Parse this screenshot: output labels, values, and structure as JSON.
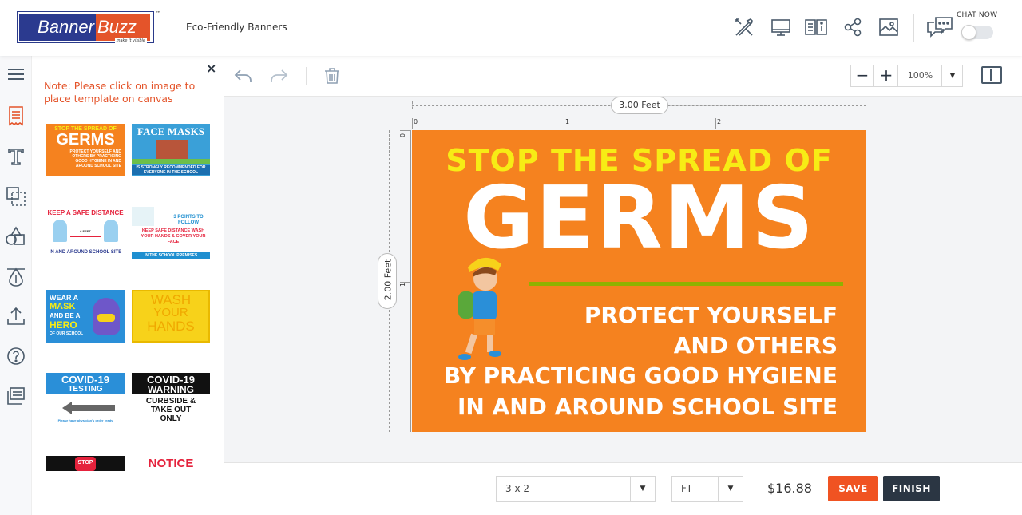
{
  "header": {
    "logo_part1": "Banner",
    "logo_part2": "Buzz",
    "logo_tm": "™",
    "logo_tagline": "make it visible",
    "product_title": "Eco-Friendly Banners",
    "icons": [
      "tools-icon",
      "monitor-icon",
      "book-info-icon",
      "share-icon",
      "image-icon",
      "chat-icon"
    ],
    "chat_label": "CHAT NOW"
  },
  "leftrail": {
    "icons": [
      "menu-icon",
      "templates-icon",
      "text-icon",
      "shapes-icon",
      "clipart-icon",
      "background-icon",
      "upload-icon",
      "help-icon",
      "layers-icon"
    ]
  },
  "panel": {
    "close": "×",
    "note": "Note: Please click on image to place template on canvas",
    "templates": [
      {
        "l1": "STOP THE SPREAD OF",
        "l2": "GERMS",
        "l3": "PROTECT YOURSELF AND OTHERS BY PRACTICING GOOD HYGIENE IN AND AROUND SCHOOL SITE"
      },
      {
        "l1": "FACE MASKS",
        "l3": "IS STRONGLY RECOMMENDED FOR EVERYONE IN THE SCHOOL"
      },
      {
        "l1": "KEEP A SAFE DISTANCE",
        "l2": "6 FEET",
        "l3": "IN AND AROUND SCHOOL SITE"
      },
      {
        "l1": "3 POINTS TO FOLLOW",
        "l2": "KEEP SAFE DISTANCE WASH YOUR HANDS & COVER YOUR FACE",
        "l3": "IN THE SCHOOL PREMISES"
      },
      {
        "l1": "WEAR A",
        "l2": "MASK",
        "l3": "AND BE A",
        "l4": "HERO",
        "l5": "OF OUR SCHOOL"
      },
      {
        "l1": "WASH",
        "l2": "YOUR",
        "l3": "HANDS"
      },
      {
        "l1": "COVID-19",
        "l2": "TESTING",
        "l3": "Please have physician's order ready"
      },
      {
        "l1": "COVID-19",
        "l2": "WARNING",
        "l3": "CURBSIDE & TAKE OUT ONLY"
      },
      {
        "l1": "STOP"
      },
      {
        "l1": "NOTICE"
      }
    ]
  },
  "toolbar": {
    "zoom_minus": "−",
    "zoom_plus": "+",
    "zoom_value": "100%",
    "zoom_caret": "▼"
  },
  "workspace": {
    "width_label": "3.00 Feet",
    "height_label": "2.00 Feet",
    "ruler_h": [
      "0",
      "1",
      "2"
    ],
    "ruler_v": [
      "0",
      "1"
    ]
  },
  "canvas": {
    "line1": "STOP THE SPREAD OF",
    "line2": "GERMS",
    "line3": "PROTECT YOURSELF",
    "line4": "AND OTHERS",
    "line5": "BY PRACTICING GOOD HYGIENE",
    "line6": "IN AND AROUND SCHOOL SITE",
    "colors": {
      "background": "#f5821f",
      "headline": "#f7ec15",
      "text": "#ffffff",
      "rule": "#8fb200"
    }
  },
  "bottombar": {
    "size_value": "3 x 2",
    "unit_value": "FT",
    "caret": "▼",
    "price": "$16.88",
    "save_label": "SAVE",
    "finish_label": "FINISH",
    "colors": {
      "save": "#f05322",
      "finish": "#2b3643"
    }
  }
}
